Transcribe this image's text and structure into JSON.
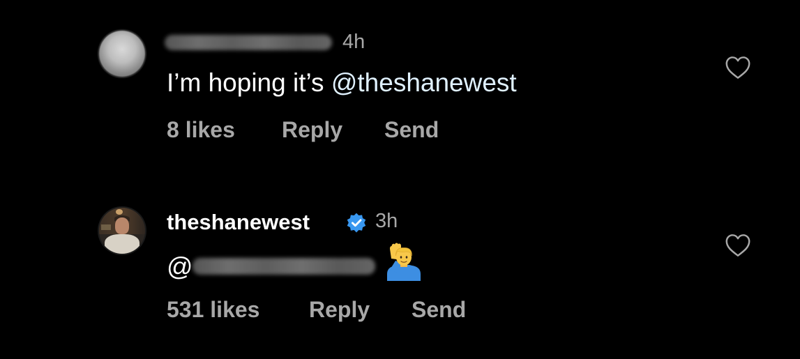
{
  "comments": [
    {
      "username": "",
      "username_blurred": true,
      "time": "4h",
      "text_plain": "I’m hoping it’s ",
      "text_mention": "@theshanewest",
      "likes": "8 likes",
      "reply_label": "Reply",
      "send_label": "Send",
      "like_icon": "heart-outline-icon"
    },
    {
      "username": "theshanewest",
      "verified_icon": "verified-badge-icon",
      "time": "3h",
      "text_at": "@",
      "mention_blurred": true,
      "emoji": "person-raising-hand-emoji",
      "likes": "531 likes",
      "reply_label": "Reply",
      "send_label": "Send",
      "like_icon": "heart-outline-icon"
    }
  ],
  "colors": {
    "background": "#000000",
    "primary_text": "#ffffff",
    "secondary_text": "#a8a8a8",
    "verified_blue": "#3897f0"
  }
}
